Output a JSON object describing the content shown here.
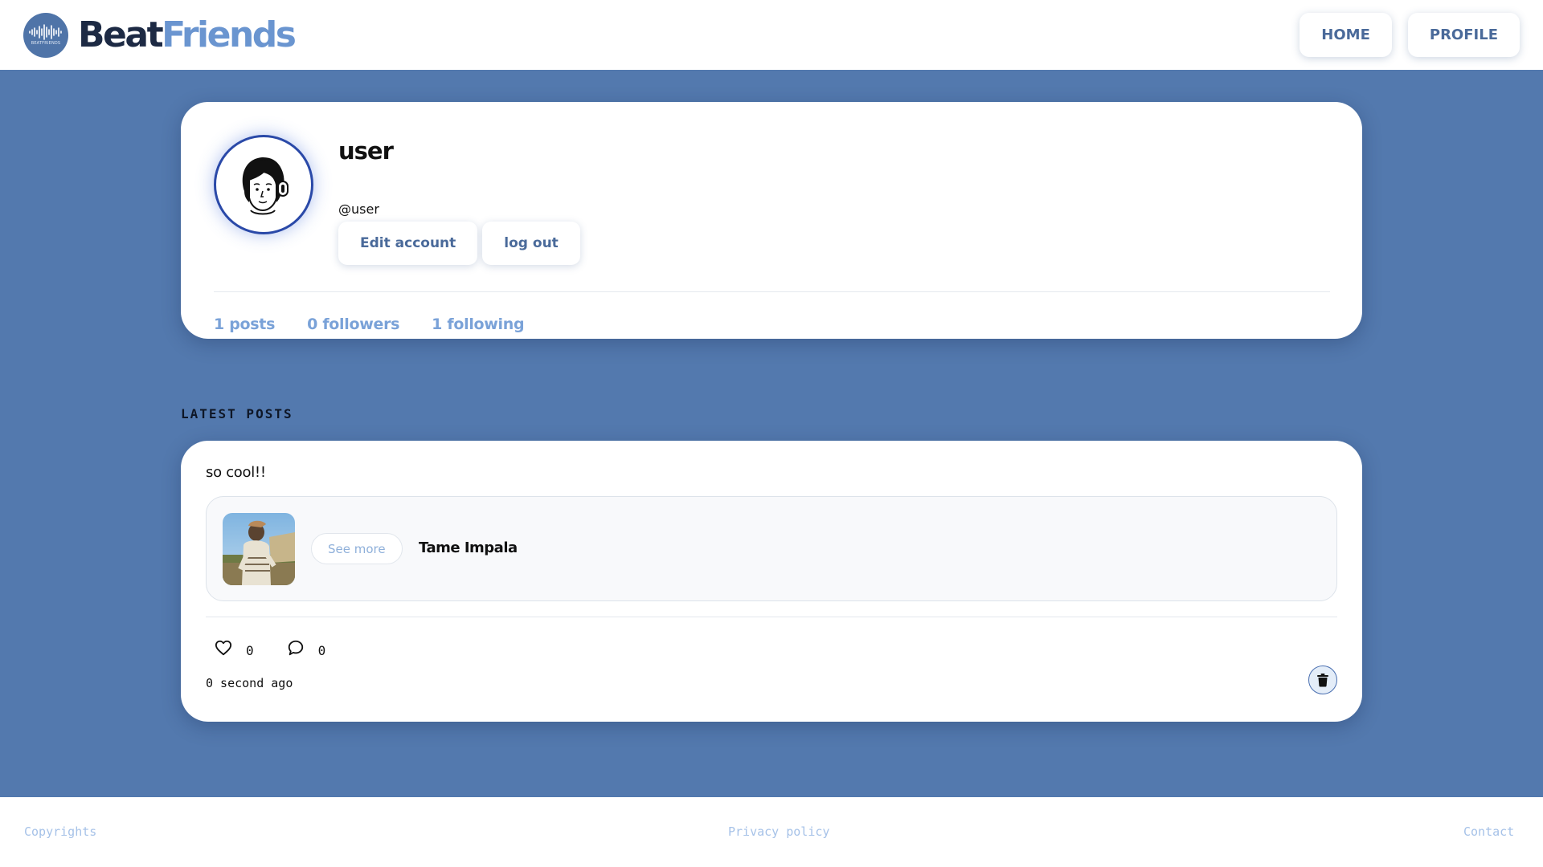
{
  "header": {
    "logo_text": "BEATFRIENDS",
    "brand_part1": "Beat",
    "brand_part2": "Friends",
    "nav": [
      {
        "label": "HOME"
      },
      {
        "label": "PROFILE"
      }
    ]
  },
  "profile": {
    "username": "user",
    "handle": "@user",
    "edit_label": "Edit account",
    "logout_label": "log out",
    "stats": {
      "posts": "1 posts",
      "followers": "0 followers",
      "following": "1 following"
    }
  },
  "latest_posts": {
    "title": "LATEST POSTS",
    "posts": [
      {
        "text": "so cool!!",
        "see_more_label": "See more",
        "artist": "Tame Impala",
        "likes": "0",
        "comments": "0",
        "time": "0 second ago"
      }
    ]
  },
  "footer": {
    "copyrights": "Copyrights",
    "privacy": "Privacy policy",
    "contact": "Contact"
  },
  "colors": {
    "background": "#5379ae",
    "brand_dark": "#1d2a44",
    "brand_light": "#6a95d0",
    "accent_text": "#4a6a9a",
    "stat_text": "#7aa2d8",
    "footer_link": "#a6c2e8"
  },
  "icons": {
    "logo": "soundwave-logo",
    "avatar": "headphones-person-avatar",
    "like": "heart-icon",
    "comment": "speech-bubble-icon",
    "delete": "trash-icon"
  }
}
